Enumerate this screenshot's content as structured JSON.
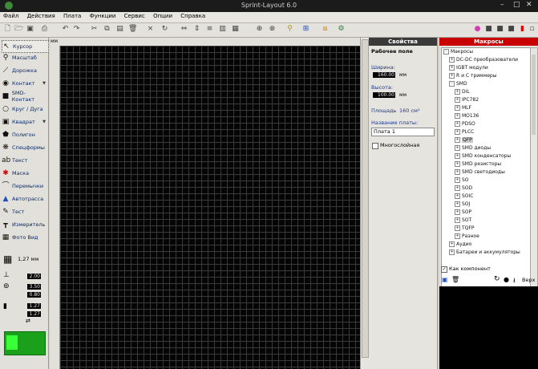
{
  "app": {
    "title": "Sprint-Layout 6.0"
  },
  "menu": [
    "Файл",
    "Действия",
    "Плата",
    "Функции",
    "Сервис",
    "Опции",
    "Справка"
  ],
  "rulers": {
    "unit": "мм"
  },
  "tools": [
    {
      "name": "cursor",
      "label": "Курсор",
      "icon": "arrow-icon",
      "active": true
    },
    {
      "name": "zoom",
      "label": "Масштаб",
      "icon": "magnifier-icon"
    },
    {
      "name": "track",
      "label": "Дорожка",
      "icon": "track-icon"
    },
    {
      "name": "pad",
      "label": "Контакт",
      "icon": "pad-icon",
      "dropdown": true
    },
    {
      "name": "smd-pad",
      "label": "SMD-Контакт",
      "icon": "smd-pad-icon"
    },
    {
      "name": "circle-arc",
      "label": "Круг / Дуга",
      "icon": "circle-icon"
    },
    {
      "name": "rectangle",
      "label": "Квадрат",
      "icon": "square-icon",
      "dropdown": true
    },
    {
      "name": "polygon",
      "label": "Полигон",
      "icon": "polygon-icon"
    },
    {
      "name": "special-forms",
      "label": "Спецформы",
      "icon": "special-forms-icon"
    },
    {
      "name": "text",
      "label": "Текст",
      "icon": "text-icon"
    },
    {
      "name": "mask",
      "label": "Маска",
      "icon": "mask-icon"
    },
    {
      "name": "jumpers",
      "label": "Перемычки",
      "icon": "jumper-icon"
    },
    {
      "name": "autoroute",
      "label": "Автотрасса",
      "icon": "autoroute-icon"
    },
    {
      "name": "test",
      "label": "Тест",
      "icon": "test-icon"
    },
    {
      "name": "measure",
      "label": "Измеритель",
      "icon": "ruler-icon"
    },
    {
      "name": "photo-view",
      "label": "Фото Вид",
      "icon": "photo-icon"
    }
  ],
  "grid": {
    "value": "1,27 мм"
  },
  "dimensions": {
    "track_width": "2.00",
    "pad_outer": "3.50",
    "pad_inner": "0.80",
    "smd_w": "1.27",
    "smd_h": "1.27"
  },
  "properties": {
    "title": "Свойства",
    "section": "Рабочее поле",
    "width_label": "Ширина:",
    "width_value": "160.00",
    "unit": "мм",
    "height_label": "Высота:",
    "height_value": "100.00",
    "area_label": "Площадь",
    "area_value": "160 см²",
    "board_name_label": "Название платы:",
    "board_name_value": "Плата 1",
    "multilayer_label": "Многослойная"
  },
  "macros": {
    "title": "Макросы",
    "tree": [
      {
        "label": "Макросы",
        "level": 0,
        "toggle": "-"
      },
      {
        "label": "DC-DC преобразователи",
        "level": 1,
        "toggle": "+"
      },
      {
        "label": "IGBT модули",
        "level": 1,
        "toggle": "+"
      },
      {
        "label": "R и C триммеры",
        "level": 1,
        "toggle": "+"
      },
      {
        "label": "SMD",
        "level": 1,
        "toggle": "-"
      },
      {
        "label": "DIL",
        "level": 2,
        "toggle": "+"
      },
      {
        "label": "IPC782",
        "level": 2,
        "toggle": "+"
      },
      {
        "label": "MLF",
        "level": 2,
        "toggle": "+"
      },
      {
        "label": "MO136",
        "level": 2,
        "toggle": "+"
      },
      {
        "label": "PDSO",
        "level": 2,
        "toggle": "+"
      },
      {
        "label": "PLCC",
        "level": 2,
        "toggle": "+"
      },
      {
        "label": "QFP",
        "level": 2,
        "toggle": "+",
        "selected": true
      },
      {
        "label": "SMD диоды",
        "level": 2,
        "toggle": "+"
      },
      {
        "label": "SMD конденсаторы",
        "level": 2,
        "toggle": "+"
      },
      {
        "label": "SMD резисторы",
        "level": 2,
        "toggle": "+"
      },
      {
        "label": "SMD светодиоды",
        "level": 2,
        "toggle": "+"
      },
      {
        "label": "SO",
        "level": 2,
        "toggle": "+"
      },
      {
        "label": "SOD",
        "level": 2,
        "toggle": "+"
      },
      {
        "label": "SOIC",
        "level": 2,
        "toggle": "+"
      },
      {
        "label": "SOJ",
        "level": 2,
        "toggle": "+"
      },
      {
        "label": "SOP",
        "level": 2,
        "toggle": "+"
      },
      {
        "label": "SOT",
        "level": 2,
        "toggle": "+"
      },
      {
        "label": "TQFP",
        "level": 2,
        "toggle": "+"
      },
      {
        "label": "Разное",
        "level": 2,
        "toggle": "+"
      },
      {
        "label": "Аудио",
        "level": 1,
        "toggle": "+"
      },
      {
        "label": "Батареи и аккумуляторы",
        "level": 1,
        "toggle": "+"
      }
    ],
    "as_component_label": "Как компонент",
    "top_label": "Верх"
  },
  "colors": {
    "title_bar": "#1b1b1b",
    "canvas": "#050505",
    "grid": "#3b3b3b",
    "props_header": "#3a3a3a",
    "macros_header": "#c80000",
    "preview_green": "#1aa01a"
  }
}
